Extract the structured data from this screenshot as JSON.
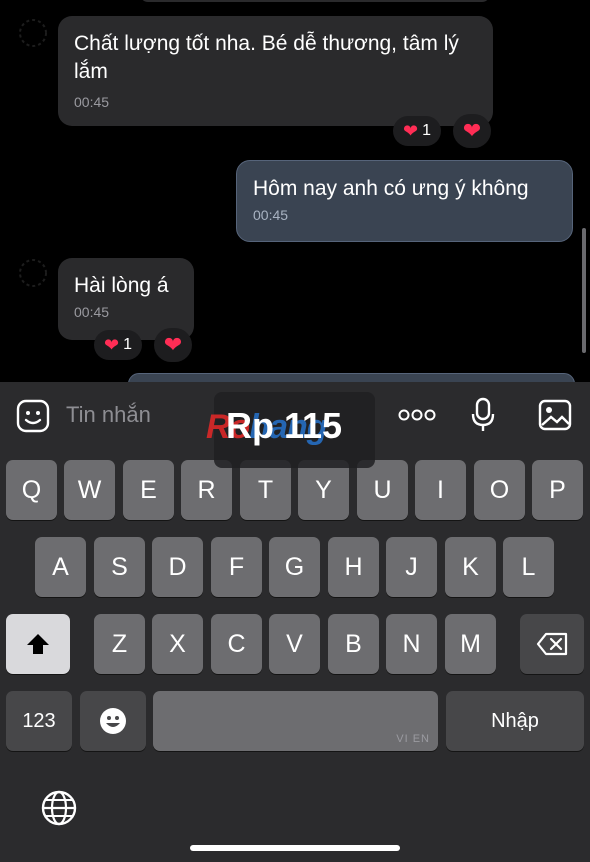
{
  "messages": [
    {
      "dir": "in",
      "text": "Chất lượng tốt nha. Bé dễ thương, tâm lý lắm",
      "time": "00:45",
      "reaction_count": "1"
    },
    {
      "dir": "out",
      "text": "Hôm nay anh có ưng ý không",
      "time": "00:45"
    },
    {
      "dir": "in",
      "text": "Hài lòng á",
      "time": "00:45",
      "reaction_count": "1"
    }
  ],
  "composer": {
    "placeholder": "Tin nhắn"
  },
  "keyboard": {
    "row1": [
      "Q",
      "W",
      "E",
      "R",
      "T",
      "Y",
      "U",
      "I",
      "O",
      "P"
    ],
    "row2": [
      "A",
      "S",
      "D",
      "F",
      "G",
      "H",
      "J",
      "K",
      "L"
    ],
    "row3": [
      "Z",
      "X",
      "C",
      "V",
      "B",
      "N",
      "M"
    ],
    "numbers_label": "123",
    "return_label": "Nhập",
    "space_hint": "VI EN"
  },
  "watermark": {
    "price": "Rp 115",
    "logo_left": "Ro",
    "logo_right": "hang"
  },
  "colors": {
    "incoming": "#2a2a2c",
    "outgoing": "#3a4452",
    "heart": "#ff2d55",
    "keyboard_bg": "#2b2b2d"
  },
  "icons": [
    "sticker-icon",
    "more-icon",
    "microphone-icon",
    "gallery-icon",
    "shift-icon",
    "backspace-icon",
    "emoji-icon",
    "globe-icon",
    "heart-icon"
  ]
}
